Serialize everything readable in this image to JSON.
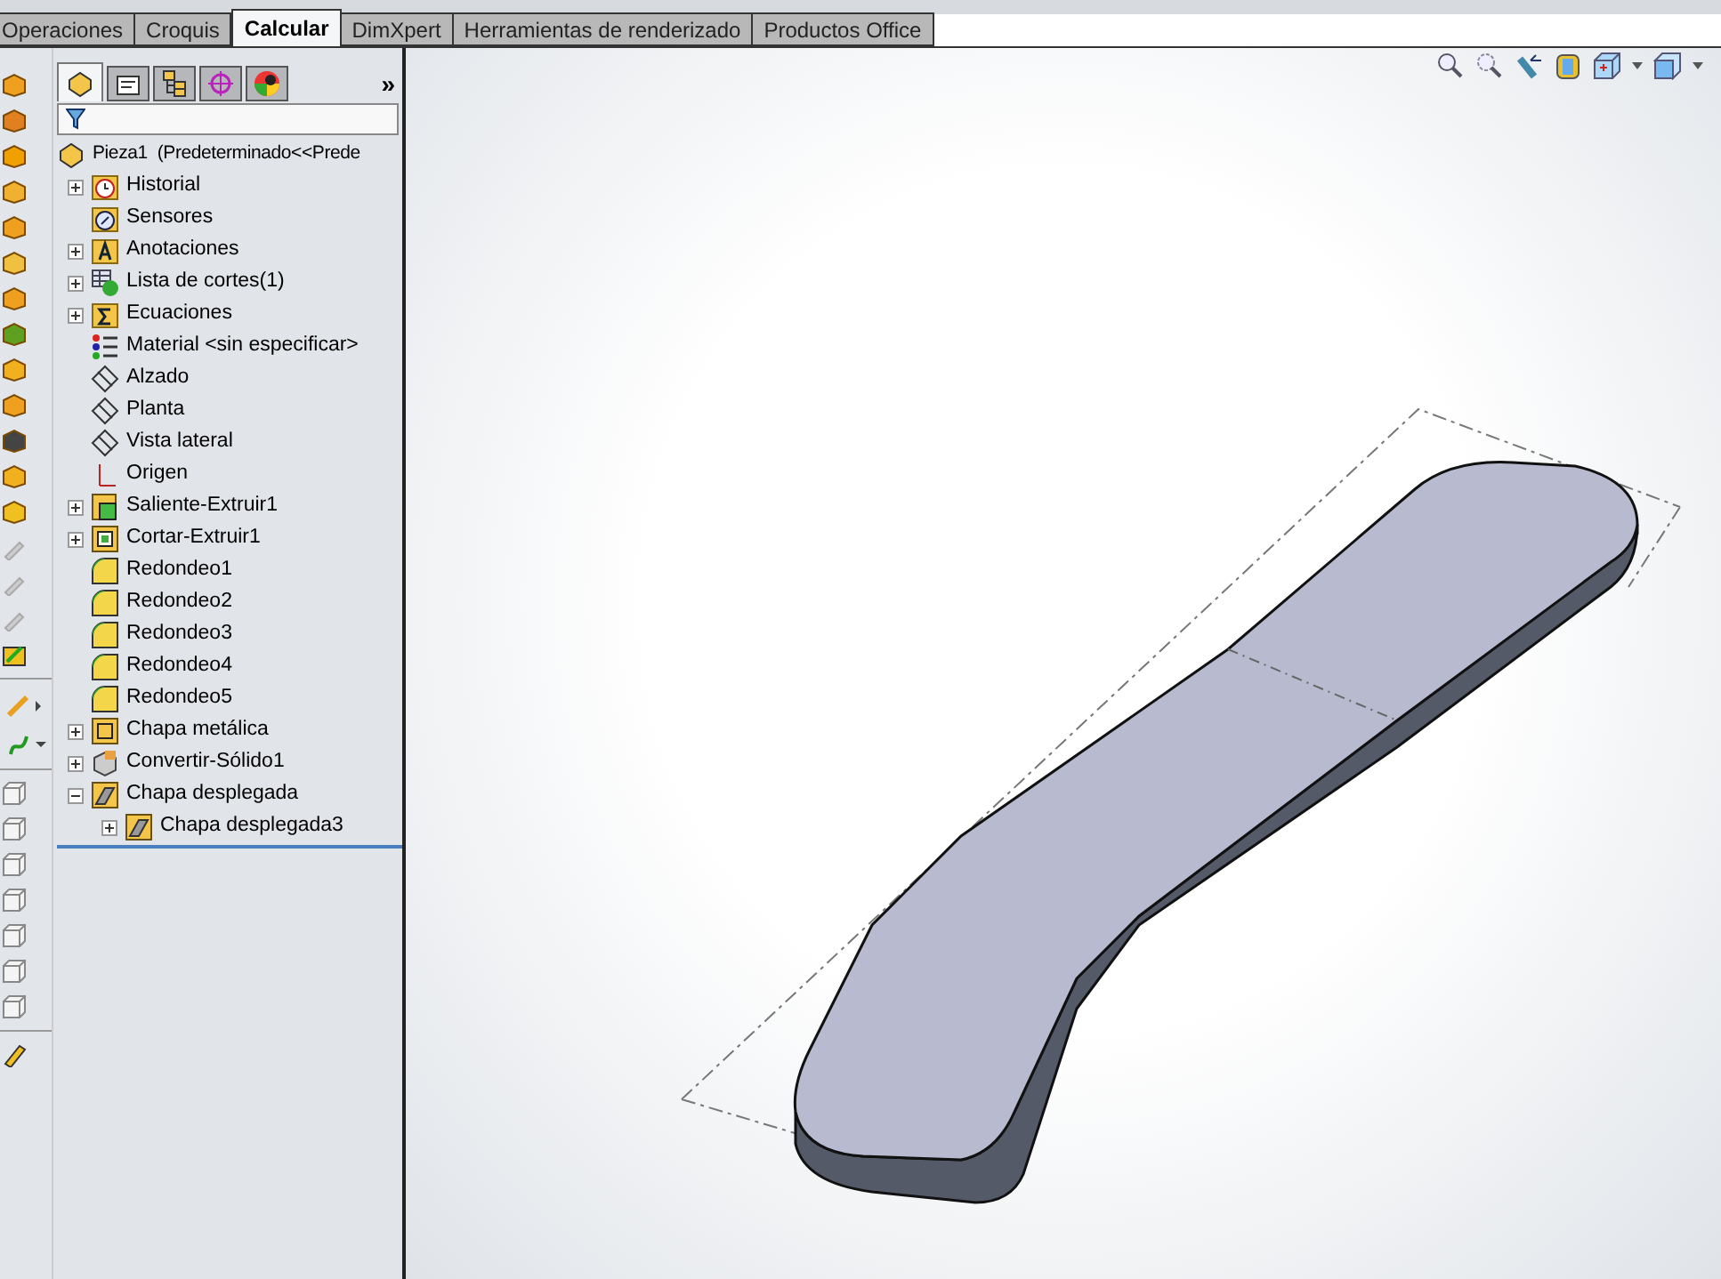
{
  "tabs": [
    {
      "label": "Operaciones",
      "selected": false
    },
    {
      "label": "Croquis",
      "selected": false
    },
    {
      "label": "Calcular",
      "selected": true
    },
    {
      "label": "DimXpert",
      "selected": false
    },
    {
      "label": "Herramientas de renderizado",
      "selected": false
    },
    {
      "label": "Productos Office",
      "selected": false
    }
  ],
  "panel_tabs": [
    {
      "kind": "part",
      "selected": true
    },
    {
      "kind": "properties",
      "selected": false
    },
    {
      "kind": "config",
      "selected": false
    },
    {
      "kind": "target",
      "selected": false
    },
    {
      "kind": "appearance",
      "selected": false
    }
  ],
  "panel_more": "»",
  "tree": {
    "label": "Pieza1  (Predeterminado<<Prede",
    "children": [
      {
        "label": "Historial",
        "kind": "history",
        "expanded": false
      },
      {
        "label": "Sensores",
        "kind": "sensor"
      },
      {
        "label": "Anotaciones",
        "kind": "annotation",
        "expanded": false
      },
      {
        "label": "Lista de cortes(1)",
        "kind": "cutlist",
        "expanded": false
      },
      {
        "label": "Ecuaciones",
        "kind": "equation",
        "expanded": false
      },
      {
        "label": "Material <sin especificar>",
        "kind": "material"
      },
      {
        "label": "Alzado",
        "kind": "plane"
      },
      {
        "label": "Planta",
        "kind": "plane"
      },
      {
        "label": "Vista lateral",
        "kind": "plane"
      },
      {
        "label": "Origen",
        "kind": "origin"
      },
      {
        "label": "Saliente-Extruir1",
        "kind": "extrude",
        "expanded": false
      },
      {
        "label": "Cortar-Extruir1",
        "kind": "cut",
        "expanded": false
      },
      {
        "label": "Redondeo1",
        "kind": "fillet"
      },
      {
        "label": "Redondeo2",
        "kind": "fillet"
      },
      {
        "label": "Redondeo3",
        "kind": "fillet"
      },
      {
        "label": "Redondeo4",
        "kind": "fillet"
      },
      {
        "label": "Redondeo5",
        "kind": "fillet"
      },
      {
        "label": "Chapa metálica",
        "kind": "sheetmetal",
        "expanded": false
      },
      {
        "label": "Convertir-Sólido1",
        "kind": "convert",
        "expanded": false
      },
      {
        "label": "Chapa desplegada",
        "kind": "flat",
        "expanded": true,
        "children": [
          {
            "label": "Chapa desplegada3",
            "kind": "flat",
            "expanded": false
          }
        ]
      }
    ]
  }
}
